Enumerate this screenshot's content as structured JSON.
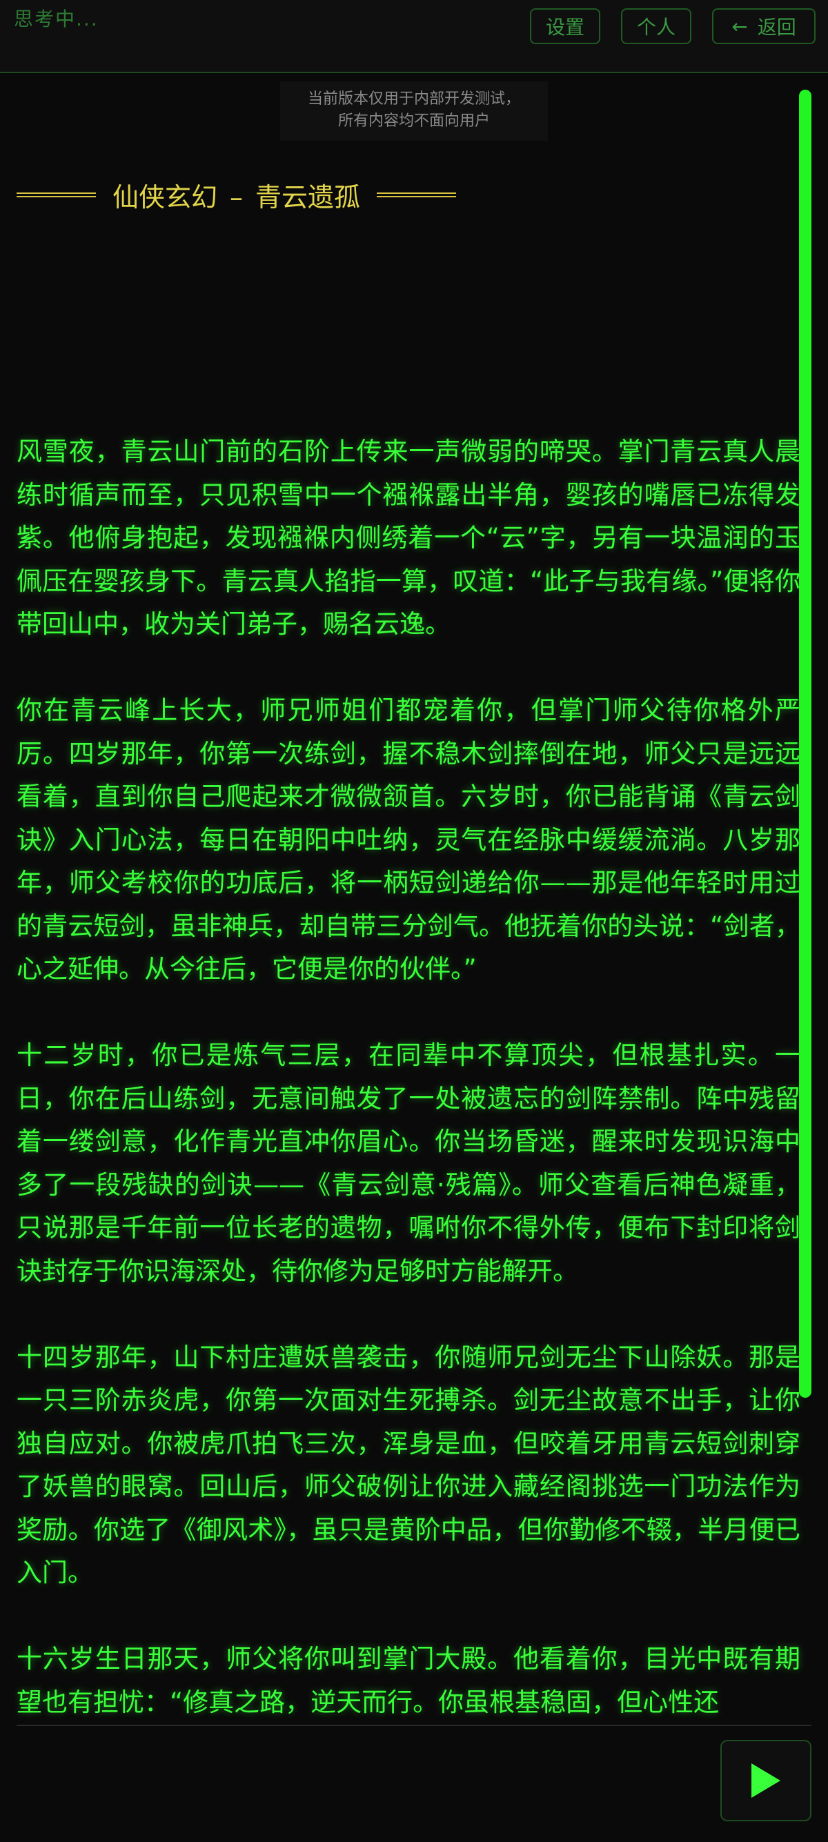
{
  "header": {
    "status_text": "思考中...",
    "settings_label": "设置",
    "profile_label": "个人",
    "back_label": "返回",
    "back_arrow": "←"
  },
  "notice": {
    "line1": "当前版本仅用于内部开发测试，",
    "line2": "所有内容均不面向用户"
  },
  "story": {
    "genre": "仙侠玄幻",
    "separator": "–",
    "title": "青云遗孤",
    "paragraphs": [
      "风雪夜，青云山门前的石阶上传来一声微弱的啼哭。掌门青云真人晨练时循声而至，只见积雪中一个襁褓露出半角，婴孩的嘴唇已冻得发紫。他俯身抱起，发现襁褓内侧绣着一个“云”字，另有一块温润的玉佩压在婴孩身下。青云真人掐指一算，叹道：“此子与我有缘。”便将你带回山中，收为关门弟子，赐名云逸。",
      "你在青云峰上长大，师兄师姐们都宠着你，但掌门师父待你格外严厉。四岁那年，你第一次练剑，握不稳木剑摔倒在地，师父只是远远看着，直到你自己爬起来才微微颔首。六岁时，你已能背诵《青云剑诀》入门心法，每日在朝阳中吐纳，灵气在经脉中缓缓流淌。八岁那年，师父考校你的功底后，将一柄短剑递给你——那是他年轻时用过的青云短剑，虽非神兵，却自带三分剑气。他抚着你的头说：“剑者，心之延伸。从今往后，它便是你的伙伴。”",
      "十二岁时，你已是炼气三层，在同辈中不算顶尖，但根基扎实。一日，你在后山练剑，无意间触发了一处被遗忘的剑阵禁制。阵中残留着一缕剑意，化作青光直冲你眉心。你当场昏迷，醒来时发现识海中多了一段残缺的剑诀——《青云剑意·残篇》。师父查看后神色凝重，只说那是千年前一位长老的遗物，嘱咐你不得外传，便布下封印将剑诀封存于你识海深处，待你修为足够时方能解开。",
      "十四岁那年，山下村庄遭妖兽袭击，你随师兄剑无尘下山除妖。那是一只三阶赤炎虎，你第一次面对生死搏杀。剑无尘故意不出手，让你独自应对。你被虎爪拍飞三次，浑身是血，但咬着牙用青云短剑刺穿了妖兽的眼窝。回山后，师父破例让你进入藏经阁挑选一门功法作为奖励。你选了《御风术》，虽只是黄阶中品，但你勤修不辍，半月便已入门。",
      "十六岁生日那天，师父将你叫到掌门大殿。他看着你，目光中既有期望也有担忧：“修真之路，逆天而行。你虽根基稳固，但心性还"
    ]
  },
  "colors": {
    "story_text": "#39ff3a",
    "title_text": "#e3d54a",
    "scrollbar": "#22f522",
    "background": "#0a0a0a"
  },
  "controls": {
    "play_icon": "play-icon"
  }
}
